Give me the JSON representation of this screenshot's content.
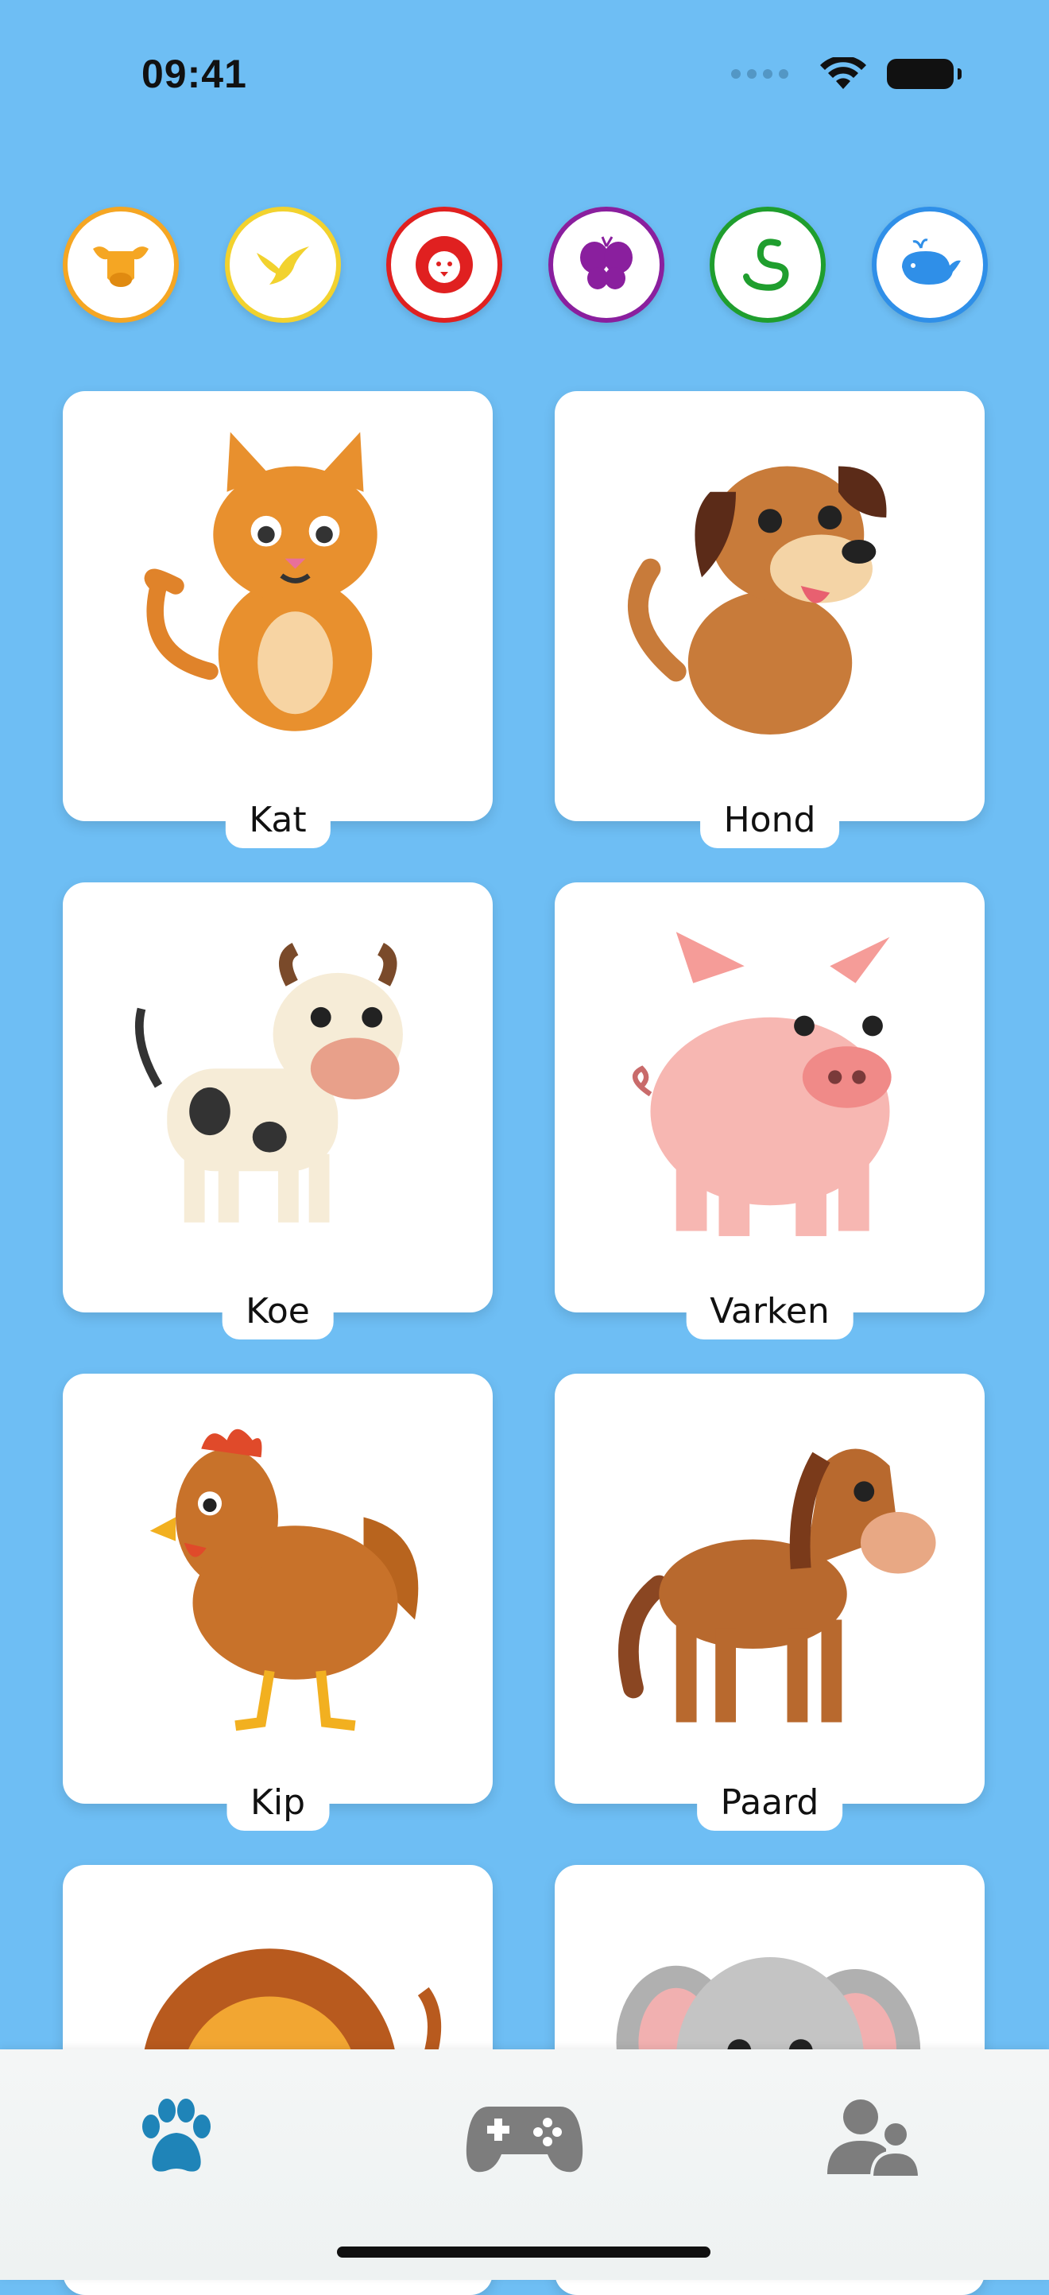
{
  "status_bar": {
    "time": "09:41"
  },
  "categories": [
    {
      "icon": "cow-icon",
      "color": "#f5a623"
    },
    {
      "icon": "bird-icon",
      "color": "#f2d22e"
    },
    {
      "icon": "lion-icon",
      "color": "#e02020"
    },
    {
      "icon": "butterfly-icon",
      "color": "#8a1f9e"
    },
    {
      "icon": "snake-icon",
      "color": "#1f9e2e"
    },
    {
      "icon": "whale-icon",
      "color": "#2f8fe8"
    }
  ],
  "animals": [
    {
      "name": "Kat"
    },
    {
      "name": "Hond"
    },
    {
      "name": "Koe"
    },
    {
      "name": "Varken"
    },
    {
      "name": "Kip"
    },
    {
      "name": "Paard"
    },
    {
      "name": ""
    },
    {
      "name": ""
    }
  ],
  "tabs": [
    {
      "icon": "paw-icon",
      "active": true,
      "color": "#1f84b8"
    },
    {
      "icon": "gamepad-icon",
      "active": false,
      "color": "#7d7d7d"
    },
    {
      "icon": "users-icon",
      "active": false,
      "color": "#7d7d7d"
    }
  ]
}
